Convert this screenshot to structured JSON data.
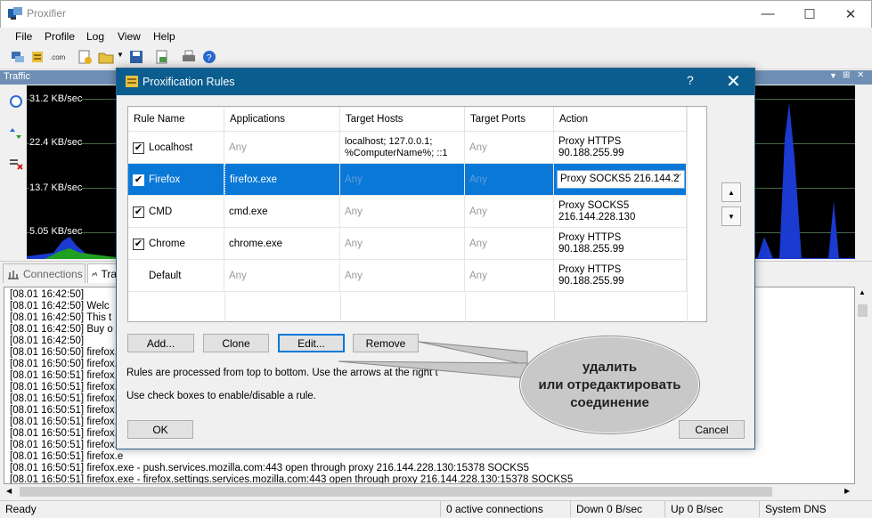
{
  "window": {
    "title": "Proxifier",
    "minimize": "—",
    "maximize": "☐",
    "close": "✕"
  },
  "menu": [
    "File",
    "Profile",
    "Log",
    "View",
    "Help"
  ],
  "toolbar_icons": [
    "connections-icon",
    "profile-icon",
    "dns-icon",
    "add-rule-icon",
    "open-icon",
    "dropdown-icon",
    "save-icon",
    "export-icon",
    "print-icon",
    "help-icon"
  ],
  "traffic": {
    "title": "Traffic",
    "scale_labels": [
      "31.2 KB/sec",
      "22.4 KB/sec",
      "13.7 KB/sec",
      "5.05 KB/sec"
    ]
  },
  "tabs": [
    {
      "label": "Connections"
    },
    {
      "label": "Tra"
    }
  ],
  "log": {
    "lines": [
      "[08.01 16:42:50]",
      "[08.01 16:42:50]      Welc",
      "[08.01 16:42:50]      This t",
      "[08.01 16:42:50]      Buy o",
      "[08.01 16:42:50]",
      "[08.01 16:50:50] firefox.e",
      "[08.01 16:50:50] firefox.e",
      "[08.01 16:50:51] firefox.e",
      "[08.01 16:50:51] firefox.e",
      "[08.01 16:50:51] firefox.e",
      "[08.01 16:50:51] firefox.e",
      "[08.01 16:50:51] firefox.e",
      "[08.01 16:50:51] firefox.e",
      "[08.01 16:50:51] firefox.e",
      "[08.01 16:50:51] firefox.e",
      "[08.01 16:50:51] firefox.exe - push.services.mozilla.com:443 open through proxy 216.144.228.130:15378 SOCKS5",
      "[08.01 16:50:51] firefox.exe - firefox.settings.services.mozilla.com:443 open through proxy 216.144.228.130:15378 SOCKS5",
      "[08.01 16:50:51] firefox.exe - search.services.mozilla.com:443 open through proxy 216.144.228.130:15378 SOCKS5"
    ]
  },
  "status": {
    "ready": "Ready",
    "connections": "0 active connections",
    "down": "Down 0 B/sec",
    "up": "Up 0 B/sec",
    "dns": "System DNS"
  },
  "dialog": {
    "title": "Proxification Rules",
    "help": "?",
    "close": "✕",
    "columns": [
      "Rule Name",
      "Applications",
      "Target Hosts",
      "Target Ports",
      "Action"
    ],
    "rules": [
      {
        "checked": true,
        "name": "Localhost",
        "apps": "Any",
        "hosts": "localhost; 127.0.0.1;\n%ComputerName%; ::1",
        "ports": "Any",
        "action": "Proxy HTTPS\n90.188.255.99"
      },
      {
        "checked": true,
        "name": "Firefox",
        "apps": "firefox.exe",
        "hosts": "Any",
        "ports": "Any",
        "action": "Proxy SOCKS5 216.144.2"
      },
      {
        "checked": true,
        "name": "CMD",
        "apps": "cmd.exe",
        "hosts": "Any",
        "ports": "Any",
        "action": "Proxy SOCKS5\n216.144.228.130"
      },
      {
        "checked": true,
        "name": "Chrome",
        "apps": "chrome.exe",
        "hosts": "Any",
        "ports": "Any",
        "action": "Proxy HTTPS\n90.188.255.99"
      },
      {
        "checked": false,
        "name": "Default",
        "apps": "Any",
        "hosts": "Any",
        "ports": "Any",
        "action": "Proxy HTTPS\n90.188.255.99"
      }
    ],
    "buttons": {
      "add": "Add...",
      "clone": "Clone",
      "edit": "Edit...",
      "remove": "Remove",
      "ok": "OK",
      "cancel": "Cancel"
    },
    "hint1": "Rules are processed from top to bottom. Use the arrows at the right t",
    "hint2": "Use check boxes to enable/disable a rule."
  },
  "callout": {
    "line1": "удалить",
    "line2": "или отредактировать",
    "line3": "соединение"
  }
}
